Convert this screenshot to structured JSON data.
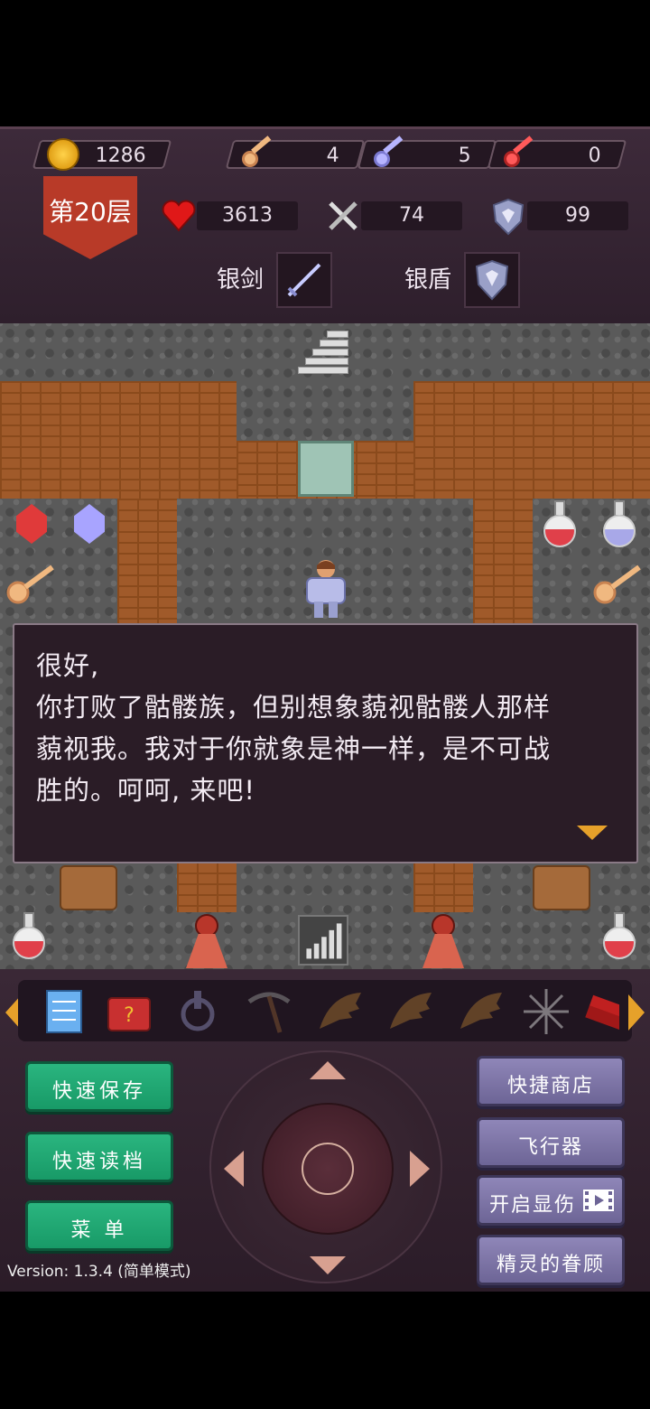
{
  "resources": {
    "gold": "1286",
    "yellow_keys": "4",
    "blue_keys": "5",
    "red_keys": "0"
  },
  "floor_label": "第20层",
  "stats": {
    "hp": "3613",
    "attack": "74",
    "defense": "99"
  },
  "equipment": {
    "weapon_label": "银剑",
    "shield_label": "银盾"
  },
  "dialog": {
    "lines": [
      "很好,",
      "你打败了骷髅族，但别想象藐视骷髅人那样",
      "藐视我。我对于你就象是神一样，是不可战",
      "胜的。呵呵, 来吧!"
    ]
  },
  "items_bar": [
    "notebook-icon",
    "monster-book-icon",
    "cross-icon",
    "pickaxe-icon",
    "wing-icon",
    "wing-down-icon",
    "wing-up-icon",
    "snowflake-icon",
    "dynamite-icon"
  ],
  "buttons": {
    "quick_save": "快速保存",
    "quick_load": "快速读档",
    "menu": "菜 单",
    "quick_shop": "快捷商店",
    "flyer": "飞行器",
    "show_damage": "开启显伤",
    "fairy_favor": "精灵的眷顾"
  },
  "version": "Version: 1.3.4 (简单模式)",
  "colors": {
    "green_button": "#1fa874",
    "purple_button": "#7d76a6",
    "floor_banner": "#b83a28",
    "dialog_arrow": "#e6a12a"
  }
}
